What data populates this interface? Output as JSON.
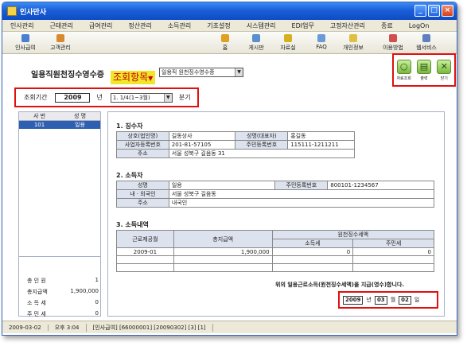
{
  "title": "인사만사",
  "menu": [
    "인사관리",
    "근태관리",
    "급여관리",
    "정산관리",
    "소득관리",
    "기초설정",
    "시스템관리",
    "EDI업무",
    "고정자산관리",
    "종료",
    "LogOn"
  ],
  "toolbar": {
    "left": [
      "인사급여",
      "고객관리"
    ],
    "right": [
      "홈",
      "게시판",
      "자료실",
      "FAQ",
      "개인정보",
      "이용방법",
      "웹서비스"
    ]
  },
  "header": {
    "title": "일용직원천징수영수증",
    "lookup": "조회항목",
    "lookup_arrow": "▼",
    "select": "일용직 원천징수영수증"
  },
  "actions": {
    "search": "자료조회",
    "print": "출력",
    "close": "닫기"
  },
  "period": {
    "label": "조회기간",
    "year": "2009",
    "year_unit": "년",
    "quarter": "1. 1/4(1~3월)",
    "quarter_unit": "분기"
  },
  "list": {
    "col1": "사 번",
    "col2": "성 명",
    "row_id": "101",
    "row_name": "일용"
  },
  "summary": [
    {
      "label": "총 인 원",
      "value": "1"
    },
    {
      "label": "총지급액",
      "value": "1,900,000"
    },
    {
      "label": "소 득 세",
      "value": "0"
    },
    {
      "label": "주 민 세",
      "value": "0"
    }
  ],
  "doc": {
    "s1": "1. 징수자",
    "company_label": "상호(법인명)",
    "company": "길동상사",
    "ceo_label": "성명(대표자)",
    "ceo": "홍길동",
    "bizno_label": "사업자등록번호",
    "bizno": "201-81-57105",
    "regno_label": "주민등록번호",
    "regno": "115111-1211211",
    "addr_label": "주소",
    "addr": "서울 성북구 길음동 31",
    "s2": "2. 소득자",
    "name_label": "성명",
    "name": "일용",
    "regno2_label": "주민등록번호",
    "regno2": "800101-1234567",
    "nat_label": "내 · 외국인",
    "nat": "서울 성북구 길음동",
    "addr2_label": "주소",
    "addr2": "내국인",
    "s3": "3. 소득내역",
    "h_period": "근로제공월",
    "h_total": "총지급액",
    "h_tax": "원천징수세액",
    "h_income": "소득세",
    "h_resident": "주민세",
    "r_period": "2009-01",
    "r_total": "1,900,000",
    "r_income": "0",
    "r_resident": "0",
    "statement": "위의 일용근로소득(원천징수세액)을 지급(영수)합니다.",
    "date_y": "2009",
    "date_y_unit": "년",
    "date_m": "03",
    "date_m_unit": "월",
    "date_d": "02",
    "date_d_unit": "일"
  },
  "status": [
    "2009-03-02",
    "오후 3:04",
    "[인사급여] [66000001] [20090302] [3] [1]"
  ]
}
